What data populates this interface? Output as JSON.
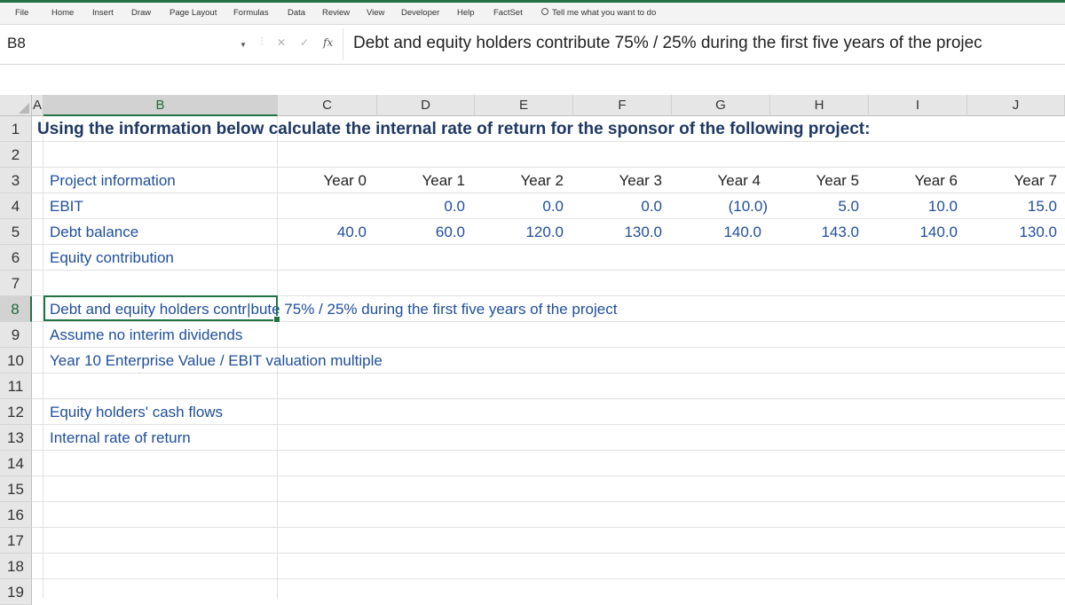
{
  "ribbon": {
    "tabs": [
      "File",
      "Home",
      "Insert",
      "Draw",
      "Page Layout",
      "Formulas",
      "Data",
      "Review",
      "View",
      "Developer",
      "Help",
      "FactSet"
    ],
    "tell_me": "Tell me what you want to do"
  },
  "formula_bar": {
    "name_box": "B8",
    "cancel_glyph": "✕",
    "enter_glyph": "✓",
    "fx_glyph": "fx",
    "content": "Debt and equity holders contribute 75% / 25% during the first five years of the projec"
  },
  "columns": [
    "A",
    "B",
    "C",
    "D",
    "E",
    "F",
    "G",
    "H",
    "I",
    "J"
  ],
  "selected_column": "B",
  "rows": [
    "1",
    "2",
    "3",
    "4",
    "5",
    "6",
    "7",
    "8",
    "9",
    "10",
    "11",
    "12",
    "13",
    "14",
    "15",
    "16",
    "17",
    "18",
    "19"
  ],
  "selected_row": "8",
  "sheet": {
    "title": "Using the information below calculate the internal rate of return for the sponsor of the following project:",
    "year_labels": [
      "Year 0",
      "Year 1",
      "Year 2",
      "Year 3",
      "Year 4",
      "Year 5",
      "Year 6",
      "Year 7"
    ],
    "row_labels": {
      "project_information": "Project information",
      "ebit": "EBIT",
      "debt_balance": "Debt balance",
      "equity_contribution": "Equity contribution",
      "debt_equity_note": "Debt and equity holders contr|bute 75% / 25% during the first five years of the project",
      "no_dividends": "Assume no interim dividends",
      "valuation_multiple": "Year 10 Enterprise Value / EBIT valuation multiple",
      "equity_cash_flows": "Equity holders' cash flows",
      "irr": "Internal rate of return"
    },
    "ebit_values": [
      "",
      "0.0",
      "0.0",
      "0.0",
      "(10.0)",
      "5.0",
      "10.0",
      "15.0"
    ],
    "debt_values": [
      "40.0",
      "60.0",
      "120.0",
      "130.0",
      "140.0",
      "143.0",
      "140.0",
      "130.0"
    ]
  }
}
